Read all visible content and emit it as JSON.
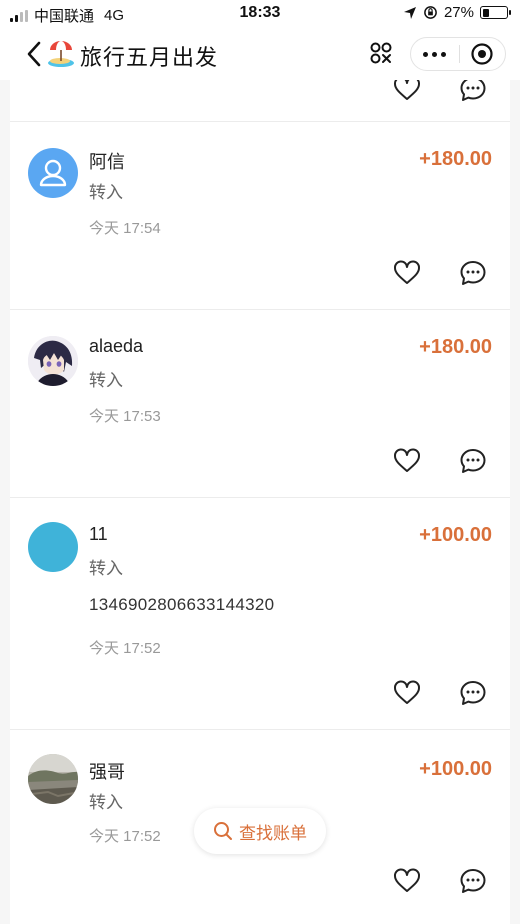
{
  "status_bar": {
    "carrier": "中国联通",
    "network": "4G",
    "time": "18:33",
    "battery": "27%",
    "battery_level": 0.27
  },
  "nav": {
    "title": "旅行五月出发",
    "title_icon": "beach-umbrella-icon"
  },
  "feed": {
    "entries": [
      {
        "name": "阿信",
        "amount": "+180.00",
        "type": "转入",
        "memo": "",
        "time": "今天 17:54",
        "avatar": "default-person-avatar"
      },
      {
        "name": "alaeda",
        "amount": "+180.00",
        "type": "转入",
        "memo": "",
        "time": "今天 17:53",
        "avatar": "anime-character-avatar"
      },
      {
        "name": "11",
        "amount": "+100.00",
        "type": "转入",
        "memo": "13469028066331443​20",
        "time": "今天 17:52",
        "avatar": "blue-circle-avatar"
      },
      {
        "name": "强哥",
        "amount": "+100.00",
        "type": "转入",
        "memo": "",
        "time": "今天 17:52",
        "avatar": "landscape-photo-avatar"
      }
    ]
  },
  "find_button": {
    "label": "查找账单"
  },
  "colors": {
    "accent": "#d9703a",
    "avatar_blue": "#5aa7f2",
    "avatar_cyan": "#3fb3d9"
  }
}
